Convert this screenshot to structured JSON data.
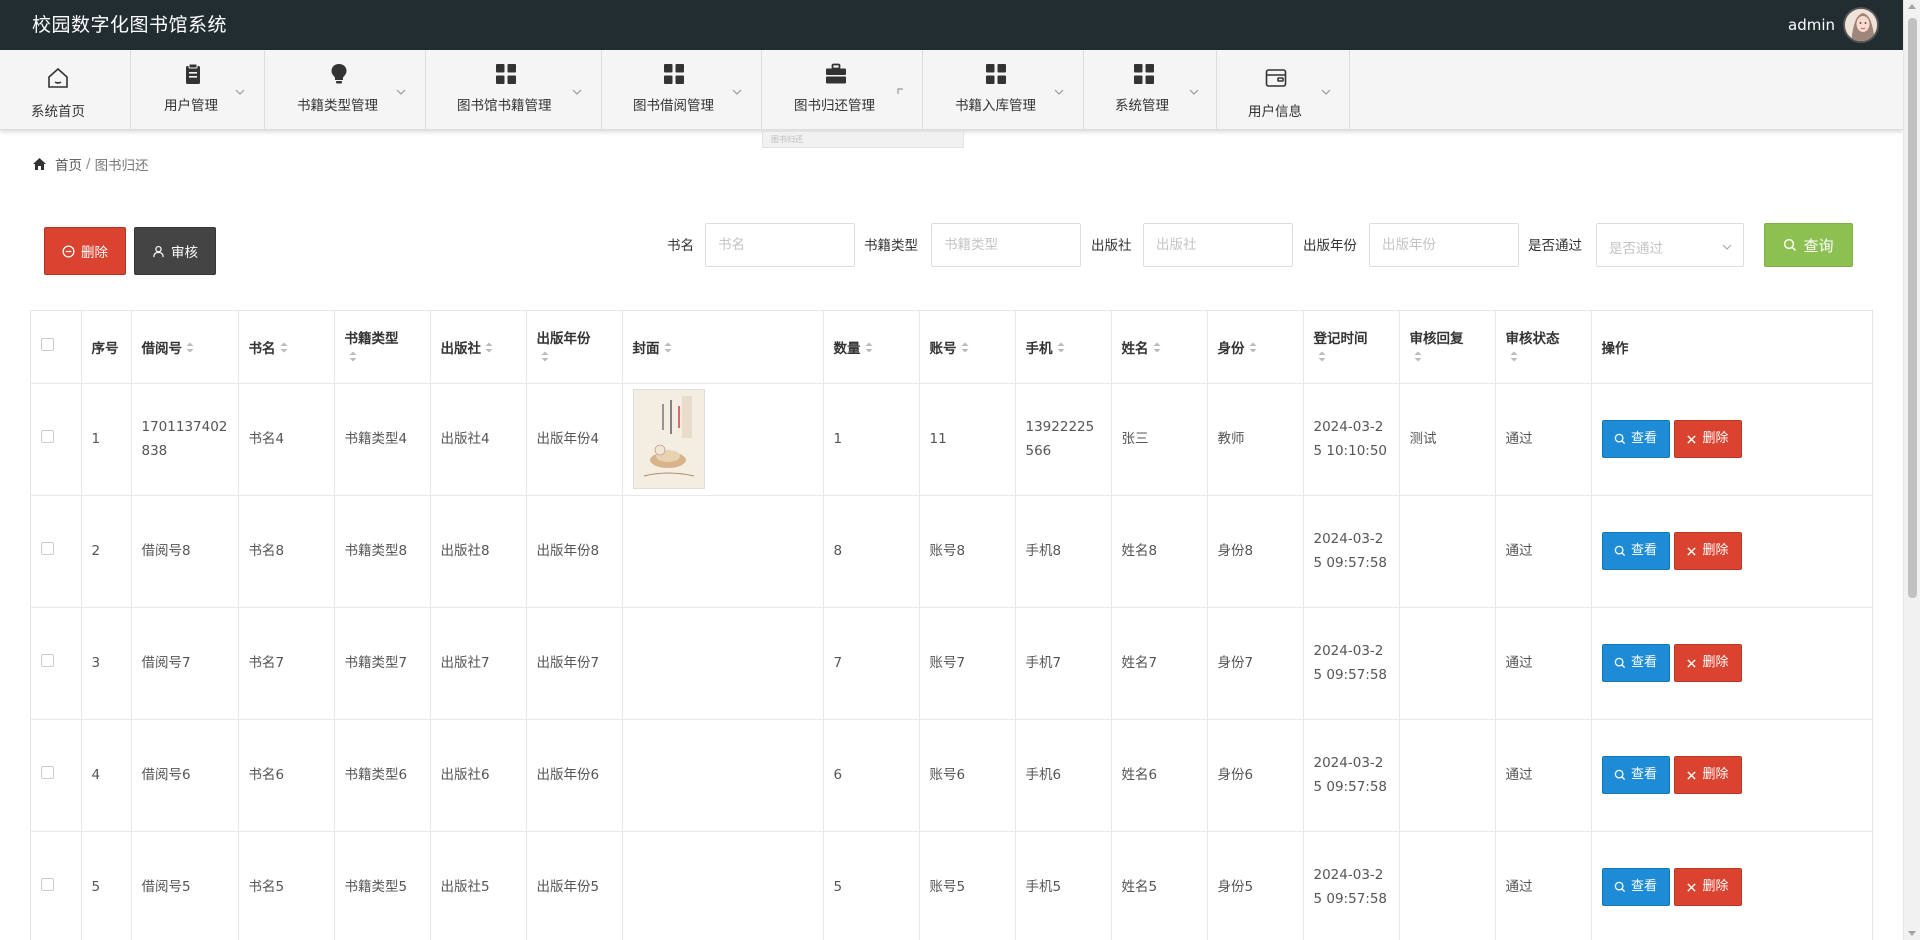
{
  "app": {
    "title": "校园数字化图书馆系统",
    "user": "admin"
  },
  "nav": [
    {
      "label": "系统首页",
      "icon": "home-icon"
    },
    {
      "label": "用户管理",
      "icon": "clipboard-icon"
    },
    {
      "label": "书籍类型管理",
      "icon": "lightbulb-icon"
    },
    {
      "label": "图书馆书籍管理",
      "icon": "grid-icon"
    },
    {
      "label": "图书借阅管理",
      "icon": "grid-icon"
    },
    {
      "label": "图书归还管理",
      "icon": "briefcase-icon"
    },
    {
      "label": "书籍入库管理",
      "icon": "grid-icon"
    },
    {
      "label": "系统管理",
      "icon": "grid-icon"
    },
    {
      "label": "用户信息",
      "icon": "wallet-icon"
    }
  ],
  "nav_popup": "图书归还",
  "breadcrumb": {
    "home": "首页",
    "current": "图书归还"
  },
  "toolbar": {
    "delete": "删除",
    "audit": "审核"
  },
  "search": {
    "book_name": {
      "label": "书名",
      "placeholder": "书名"
    },
    "book_type": {
      "label": "书籍类型",
      "placeholder": "书籍类型"
    },
    "publisher": {
      "label": "出版社",
      "placeholder": "出版社"
    },
    "year": {
      "label": "出版年份",
      "placeholder": "出版年份"
    },
    "approved": {
      "label": "是否通过",
      "placeholder": "是否通过"
    },
    "query": "查询"
  },
  "table": {
    "headers": [
      "序号",
      "借阅号",
      "书名",
      "书籍类型",
      "出版社",
      "出版年份",
      "封面",
      "数量",
      "账号",
      "手机",
      "姓名",
      "身份",
      "登记时间",
      "审核回复",
      "审核状态",
      "操作"
    ],
    "rows": [
      {
        "no": "1",
        "borrow_no": "1701137402838",
        "book": "书名4",
        "type": "书籍类型4",
        "publisher": "出版社4",
        "year": "出版年份4",
        "has_cover": true,
        "qty": "1",
        "account": "11",
        "phone": "13922225566",
        "name": "张三",
        "identity": "教师",
        "time": "2024-03-25 10:10:50",
        "reply": "测试",
        "status": "通过"
      },
      {
        "no": "2",
        "borrow_no": "借阅号8",
        "book": "书名8",
        "type": "书籍类型8",
        "publisher": "出版社8",
        "year": "出版年份8",
        "has_cover": false,
        "qty": "8",
        "account": "账号8",
        "phone": "手机8",
        "name": "姓名8",
        "identity": "身份8",
        "time": "2024-03-25 09:57:58",
        "reply": "",
        "status": "通过"
      },
      {
        "no": "3",
        "borrow_no": "借阅号7",
        "book": "书名7",
        "type": "书籍类型7",
        "publisher": "出版社7",
        "year": "出版年份7",
        "has_cover": false,
        "qty": "7",
        "account": "账号7",
        "phone": "手机7",
        "name": "姓名7",
        "identity": "身份7",
        "time": "2024-03-25 09:57:58",
        "reply": "",
        "status": "通过"
      },
      {
        "no": "4",
        "borrow_no": "借阅号6",
        "book": "书名6",
        "type": "书籍类型6",
        "publisher": "出版社6",
        "year": "出版年份6",
        "has_cover": false,
        "qty": "6",
        "account": "账号6",
        "phone": "手机6",
        "name": "姓名6",
        "identity": "身份6",
        "time": "2024-03-25 09:57:58",
        "reply": "",
        "status": "通过"
      },
      {
        "no": "5",
        "borrow_no": "借阅号5",
        "book": "书名5",
        "type": "书籍类型5",
        "publisher": "出版社5",
        "year": "出版年份5",
        "has_cover": false,
        "qty": "5",
        "account": "账号5",
        "phone": "手机5",
        "name": "姓名5",
        "identity": "身份5",
        "time": "2024-03-25 09:57:58",
        "reply": "",
        "status": "通过"
      }
    ],
    "actions": {
      "view": "查看",
      "delete": "删除"
    }
  },
  "colors": {
    "topbar": "#222d32",
    "danger": "#d9432f",
    "dark": "#444444",
    "query": "#8cc152",
    "view": "#1d8bd6"
  }
}
